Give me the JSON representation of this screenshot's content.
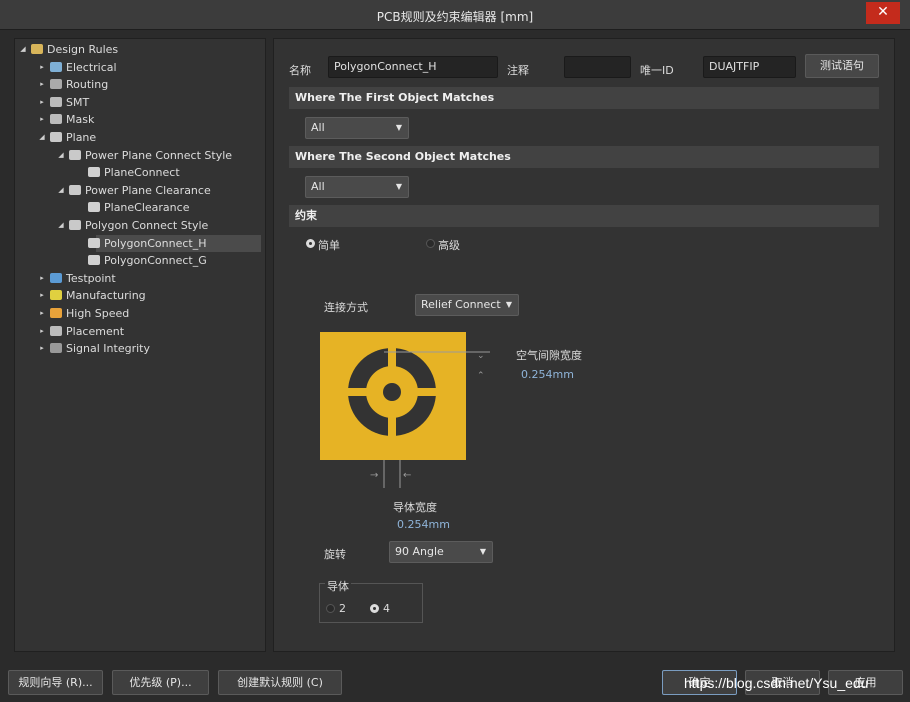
{
  "window": {
    "title": "PCB规则及约束编辑器 [mm]",
    "close_glyph": "✕"
  },
  "tree": {
    "items": [
      {
        "label": "Design Rules",
        "icon": "folder-rules-icon",
        "expand": "◢"
      },
      {
        "label": "Electrical",
        "icon": "electrical-icon",
        "expand": "▸"
      },
      {
        "label": "Routing",
        "icon": "routing-icon",
        "expand": "▸"
      },
      {
        "label": "SMT",
        "icon": "smt-icon",
        "expand": "▸"
      },
      {
        "label": "Mask",
        "icon": "mask-icon",
        "expand": "▸"
      },
      {
        "label": "Plane",
        "icon": "plane-icon",
        "expand": "◢"
      },
      {
        "label": "Power Plane Connect Style",
        "icon": "rule-category-icon",
        "expand": "◢"
      },
      {
        "label": "PlaneConnect",
        "icon": "rule-icon",
        "expand": ""
      },
      {
        "label": "Power Plane Clearance",
        "icon": "rule-category-icon",
        "expand": "◢"
      },
      {
        "label": "PlaneClearance",
        "icon": "rule-icon",
        "expand": ""
      },
      {
        "label": "Polygon Connect Style",
        "icon": "rule-category-icon",
        "expand": "◢"
      },
      {
        "label": "PolygonConnect_H",
        "icon": "rule-icon",
        "expand": ""
      },
      {
        "label": "PolygonConnect_G",
        "icon": "rule-icon",
        "expand": ""
      },
      {
        "label": "Testpoint",
        "icon": "testpoint-icon",
        "expand": "▸"
      },
      {
        "label": "Manufacturing",
        "icon": "manufacturing-icon",
        "expand": "▸"
      },
      {
        "label": "High Speed",
        "icon": "high-speed-icon",
        "expand": "▸"
      },
      {
        "label": "Placement",
        "icon": "placement-icon",
        "expand": "▸"
      },
      {
        "label": "Signal Integrity",
        "icon": "signal-integrity-icon",
        "expand": "▸"
      }
    ]
  },
  "rule": {
    "name_label": "名称",
    "name_value": "PolygonConnect_H",
    "comment_label": "注释",
    "comment_value": "",
    "uid_label": "唯一ID",
    "uid_value": "DUAJTFIP",
    "test_button": "测试语句"
  },
  "first_match": {
    "header": "Where The First Object Matches",
    "value": "All"
  },
  "second_match": {
    "header": "Where The Second Object Matches",
    "value": "All"
  },
  "constraints": {
    "header": "约束",
    "mode_simple": "简单",
    "mode_advanced": "高级",
    "connect_label": "连接方式",
    "connect_value": "Relief Connect",
    "air_gap_label": "空气间隙宽度",
    "air_gap_value": "0.254mm",
    "conductor_width_label": "导体宽度",
    "conductor_width_value": "0.254mm",
    "rotation_label": "旋转",
    "rotation_value": "90 Angle",
    "conductors_group": "导体",
    "conductors_option_2": "2",
    "conductors_option_4": "4"
  },
  "footer": {
    "wizard": "规则向导 (R)...",
    "priority": "优先级 (P)...",
    "create_default": "创建默认规则 (C)",
    "ok": "确定",
    "cancel": "取消",
    "apply": "应用",
    "watermark": "https://blog.csdn.net/Ysu_edu"
  },
  "colors": {
    "pad_gold": "#e6b325",
    "panel": "#333333",
    "section": "#424242",
    "accent_blue": "#8fb4d9"
  }
}
